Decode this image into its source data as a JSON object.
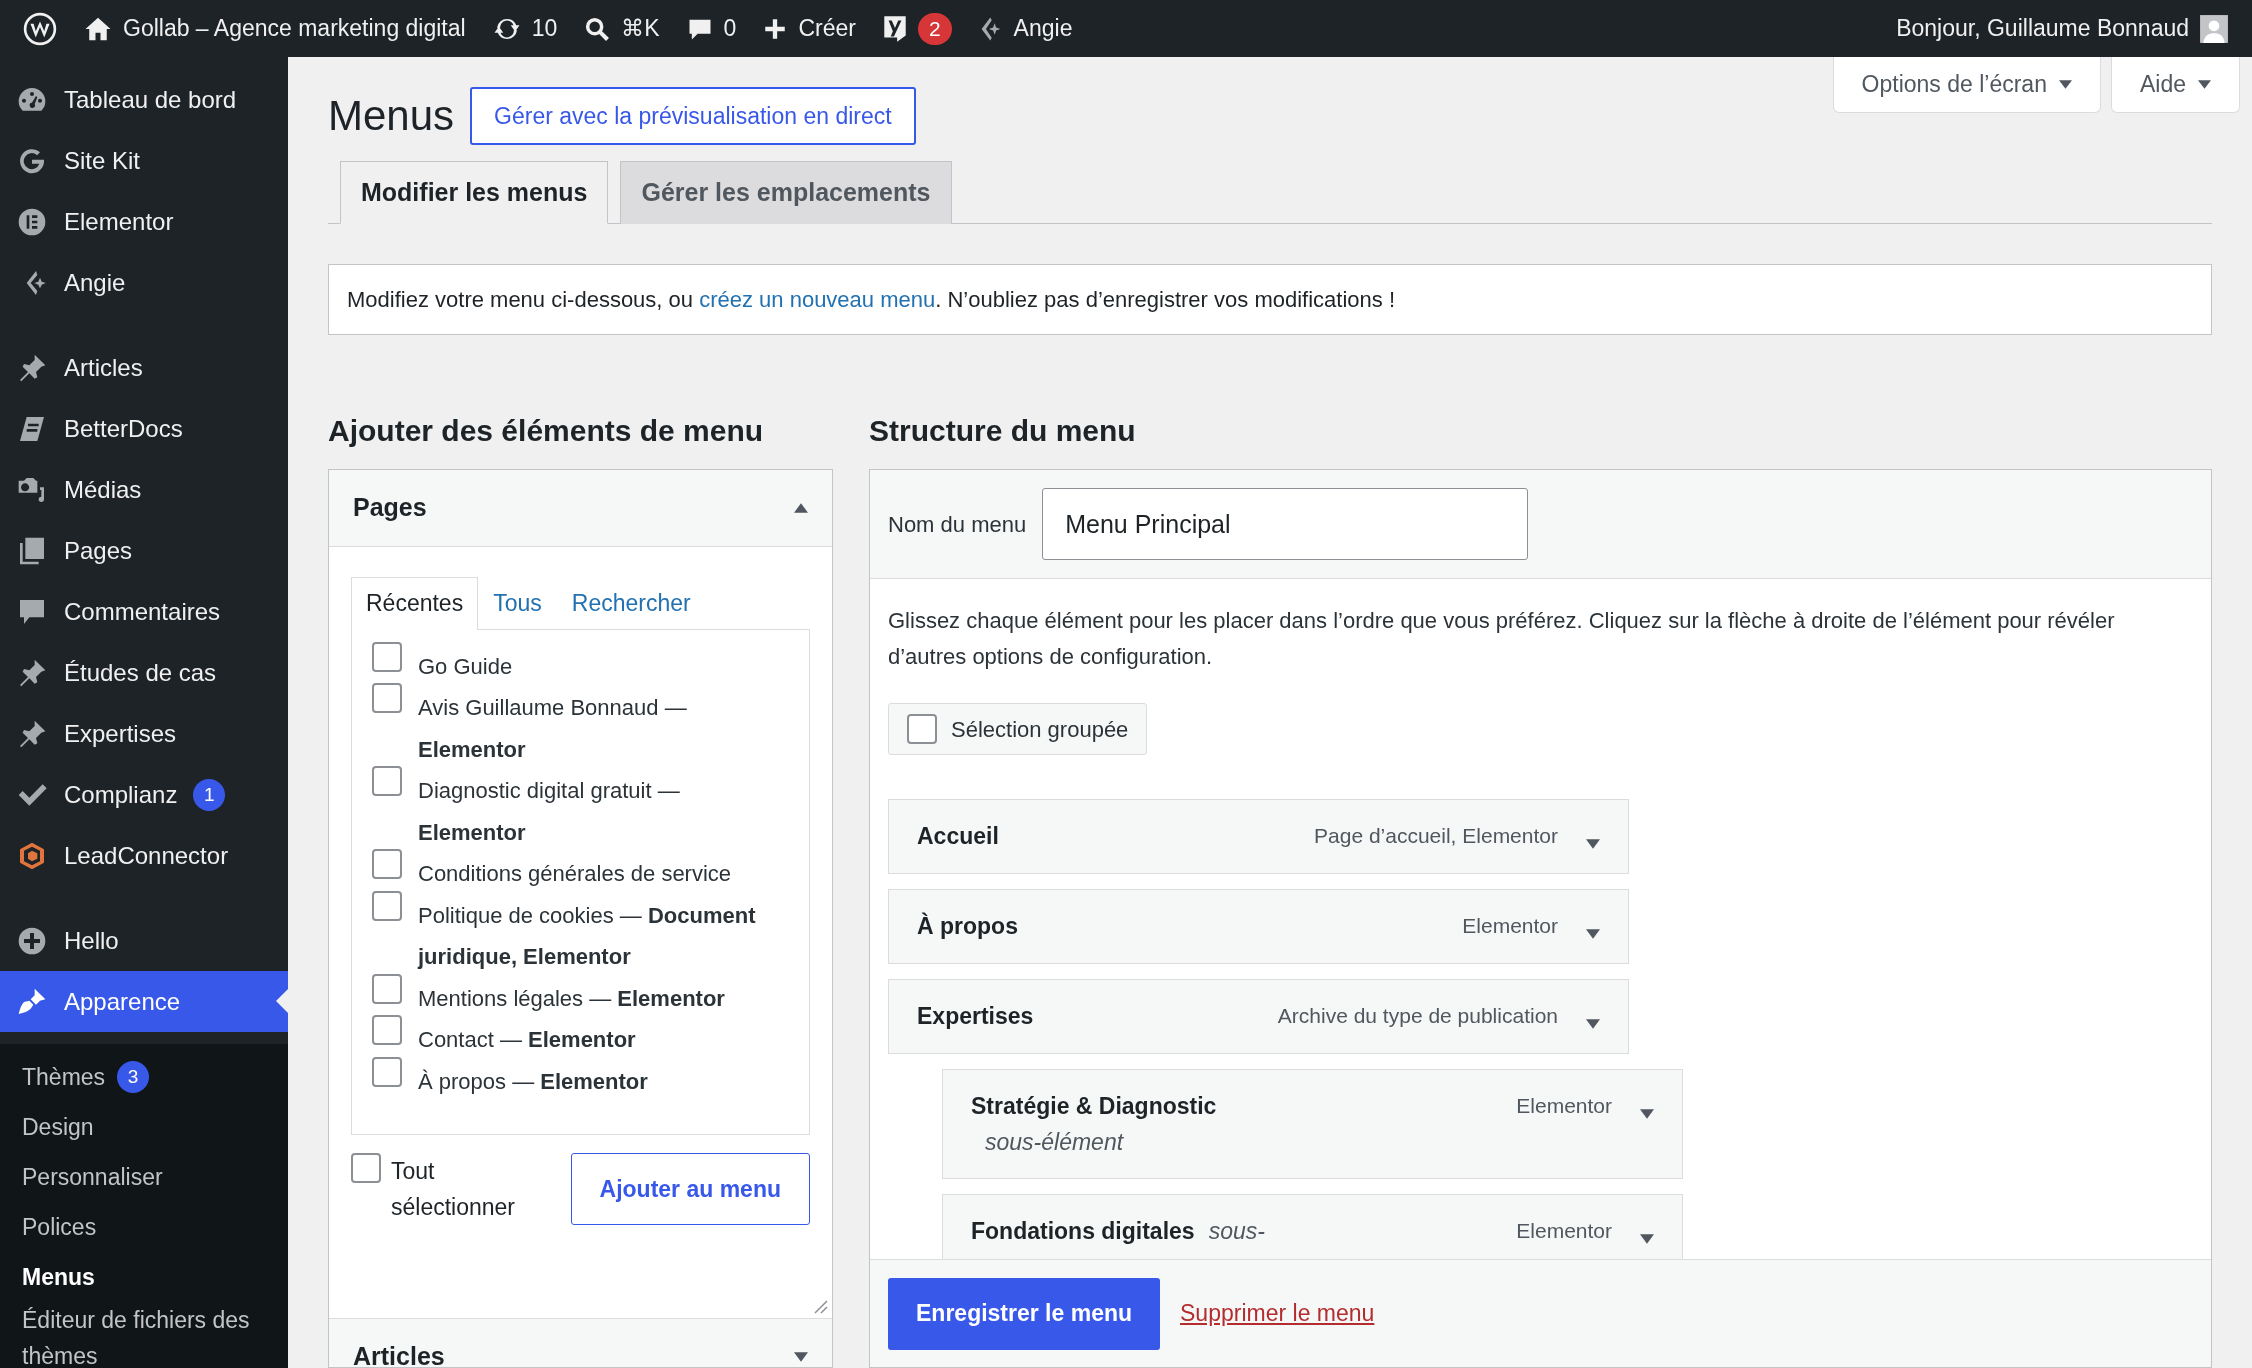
{
  "admin_bar": {
    "site_title": "Gollab – Agence marketing digital",
    "updates": "10",
    "search_shortcut": "⌘K",
    "comments": "0",
    "new_label": "Créer",
    "seo_badge": "2",
    "assistant": "Angie",
    "greeting": "Bonjour, Guillaume Bonnaud"
  },
  "sidebar": {
    "groups": [
      {
        "items": [
          {
            "label": "Tableau de bord",
            "selected": false
          },
          {
            "label": "Site Kit",
            "selected": false
          },
          {
            "label": "Elementor",
            "selected": false
          },
          {
            "label": "Angie",
            "selected": false
          }
        ]
      },
      {
        "items": [
          {
            "label": "Articles",
            "selected": false
          },
          {
            "label": "BetterDocs",
            "selected": false
          },
          {
            "label": "Médias",
            "selected": false
          },
          {
            "label": "Pages",
            "selected": false
          },
          {
            "label": "Commentaires",
            "selected": false
          },
          {
            "label": "Études de cas",
            "selected": false
          },
          {
            "label": "Expertises",
            "selected": false
          },
          {
            "label": "Complianz",
            "selected": false,
            "badge": "1"
          },
          {
            "label": "LeadConnector",
            "selected": false
          }
        ]
      },
      {
        "items": [
          {
            "label": "Hello",
            "selected": false
          },
          {
            "label": "Apparence",
            "selected": true
          }
        ]
      }
    ],
    "submenu": [
      {
        "label": "Thèmes",
        "selected": false,
        "badge": "3"
      },
      {
        "label": "Design",
        "selected": false
      },
      {
        "label": "Personnaliser",
        "selected": false
      },
      {
        "label": "Polices",
        "selected": false
      },
      {
        "label": "Menus",
        "selected": true
      },
      {
        "label": "Éditeur de fichiers des thèmes",
        "selected": false
      }
    ]
  },
  "screen_links": [
    "Options de l’écran",
    "Aide"
  ],
  "page": {
    "title": "Menus",
    "live_preview_button": "Gérer avec la prévisualisation en direct",
    "tabs": [
      {
        "label": "Modifier les menus",
        "selected": true
      },
      {
        "label": "Gérer les emplacements",
        "selected": false
      }
    ],
    "notice": {
      "before": "Modifiez votre menu ci-dessous, ou ",
      "link": "créez un nouveau menu",
      "after": ". N’oubliez pas d’enregistrer vos modifications !"
    }
  },
  "add_items": {
    "heading": "Ajouter des éléments de menu",
    "panels": [
      {
        "title": "Pages",
        "expanded": true,
        "tabs": [
          {
            "label": "Récentes",
            "selected": true
          },
          {
            "label": "Tous",
            "selected": false
          },
          {
            "label": "Rechercher",
            "selected": false
          }
        ],
        "items": [
          {
            "label": "Go Guide",
            "checked": false
          },
          {
            "label": "Avis Guillaume Bonnaud — **Elementor**",
            "checked": false
          },
          {
            "label": "Diagnostic digital gratuit — **Elementor**",
            "checked": false
          },
          {
            "label": "Conditions générales de service",
            "checked": false
          },
          {
            "label": "Politique de cookies — **Document juridique, Elementor**",
            "checked": false
          },
          {
            "label": "Mentions légales — **Elementor**",
            "checked": false
          },
          {
            "label": "Contact — **Elementor**",
            "checked": false
          },
          {
            "label": "À propos — **Elementor**",
            "checked": false
          }
        ],
        "select_all": {
          "label": "Tout sélectionner",
          "checked": false
        },
        "add_button": "Ajouter au menu"
      },
      {
        "title": "Articles",
        "expanded": false
      }
    ]
  },
  "structure": {
    "heading": "Structure du menu",
    "name_label": "Nom du menu",
    "name_value": "Menu Principal",
    "instructions": "Glissez chaque élément pour les placer dans l’ordre que vous préférez. Cliquez sur la flèche à droite de l’élément pour révéler d’autres options de configuration.",
    "bulk_select": {
      "label": "Sélection groupée",
      "checked": false
    },
    "items": [
      {
        "title": "Accueil",
        "type": "Page d’accueil, Elementor"
      },
      {
        "title": "À propos",
        "type": "Elementor"
      },
      {
        "title": "Expertises",
        "type": "Archive du type de publication",
        "children": [
          {
            "title": "Stratégie & Diagnostic",
            "note": "sous-élément",
            "type": "Elementor"
          },
          {
            "title": "Fondations digitales",
            "note": "sous-",
            "type": "Elementor"
          }
        ]
      }
    ],
    "save_button": "Enregistrer le menu",
    "delete_link": "Supprimer le menu"
  }
}
